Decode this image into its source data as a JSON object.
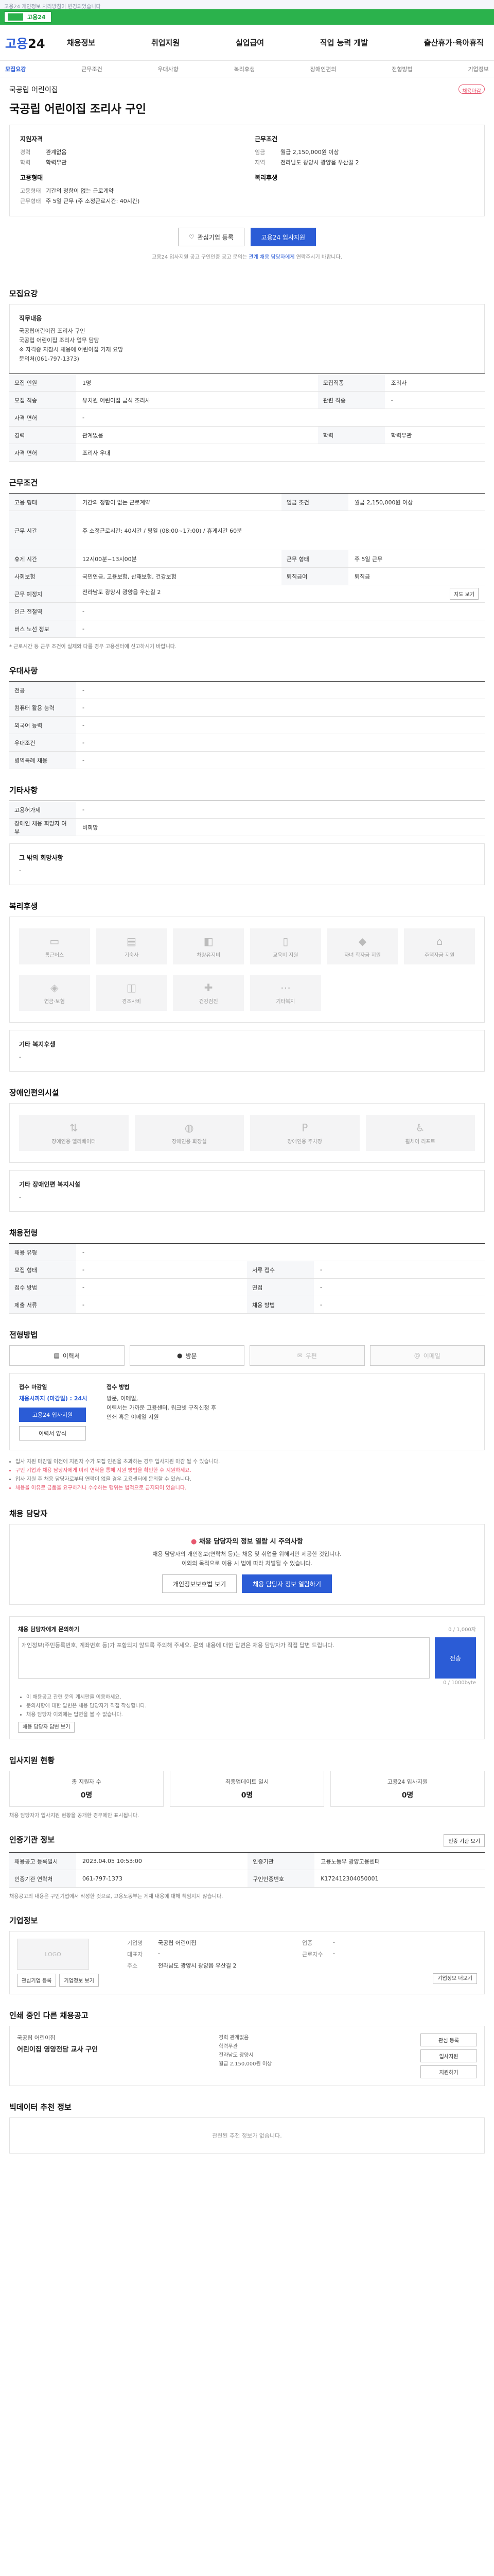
{
  "notice": "고용24 개인정보 처리방침이 변경되었습니다",
  "banner": {
    "label": "고용24"
  },
  "header": {
    "logo_main": "고용",
    "logo_num": "24",
    "gnb": [
      "채용정보",
      "취업지원",
      "실업급여",
      "직업 능력 개발",
      "출산휴가·육아휴직"
    ]
  },
  "subtabs": [
    "모집요강",
    "근무조건",
    "우대사항",
    "복리후생",
    "장애인편의",
    "전형방법",
    "기업정보"
  ],
  "company": {
    "name": "국공립 어린이집",
    "tag": "채용마감"
  },
  "job_title": "국공립 어린이집 조리사 구인",
  "summary": {
    "left_title": "지원자격",
    "left": [
      {
        "k": "경력",
        "v": "관계없음"
      },
      {
        "k": "학력",
        "v": "학력무관"
      }
    ],
    "left2_title": "고용형태",
    "left2": [
      {
        "k": "고용형태",
        "v": "기간의 정함이 없는 근로계약"
      },
      {
        "k": "근무형태",
        "v": "주 5일 근무 (주 소정근로시간: 40시간)"
      }
    ],
    "right_title": "근무조건",
    "right": [
      {
        "k": "임금",
        "v": "월급 2,150,000원 이상"
      },
      {
        "k": "지역",
        "v": "전라남도 광양시 광양읍 우산길 2"
      }
    ],
    "right2_title": "복리후생"
  },
  "actions": {
    "interest": "관심기업 등록",
    "apply": "고용24 입사지원"
  },
  "apply_note_pre": "고용24 입사지원 공고 구인인증 공고 문의는 ",
  "apply_note_link": "관계 채용 담당자에게",
  "apply_note_post": " 연락주시기 바랍니다.",
  "sections": {
    "recruit": "모집요강",
    "work": "근무조건",
    "prefer": "우대사항",
    "etc": "기타사항",
    "welfare": "복리후생",
    "disabled": "장애인편의시설",
    "selection": "채용전형",
    "method": "전형방법",
    "contact": "채용 담당자",
    "qna": "채용 담당자에게 문의하기",
    "stats": "입사지원 현황",
    "provider": "인증기관 정보",
    "company": "기업정보",
    "other": "인쇄 중인 다른 채용공고",
    "bottom": "빅데이터 추천 정보"
  },
  "recruit": {
    "box_title": "직무내용",
    "box_lines": [
      "국공립어린이집 조리사 구인",
      "국공립 어린이집 조리사 업무 담당",
      "※ 자격증 지참시 채용에 어린이집 기재 요망",
      "문의처(061-797-1373)"
    ],
    "rows": [
      {
        "k": "모집 인원",
        "v": "1명",
        "k2": "모집직종",
        "v2": "조리사"
      },
      {
        "k": "모집 직종",
        "v": "유치원 어린이집 급식 조리사",
        "k2": "관련 직종",
        "v2": "-"
      },
      {
        "k": "자격 면허",
        "v": "-",
        "k2": "",
        "v2": ""
      },
      {
        "k": "경력",
        "v": "관계없음",
        "k2": "학력",
        "v2": "학력무관"
      },
      {
        "k": "자격 면허",
        "v": "조리사 우대",
        "k2": "",
        "v2": ""
      }
    ]
  },
  "work": {
    "rows": [
      {
        "k": "고용 형태",
        "v": "기간의 정함이 없는 근로계약",
        "k2": "임금 조건",
        "v2": "월급 2,150,000원 이상"
      },
      {
        "k": "근무 시간",
        "v": "주 소정근로시간: 40시간 / 평일 (08:00~17:00) / 휴게시간 60분",
        "k2": "",
        "v2": ""
      },
      {
        "k": "휴게 시간",
        "v": "12시00분~13시00분",
        "k2": "근무 형태",
        "v2": "주 5일 근무"
      },
      {
        "k": "사회보험",
        "v": "국민연금, 고용보험, 산재보험, 건강보험",
        "k2": "퇴직급여",
        "v2": "퇴직금"
      },
      {
        "k": "근무 예정지",
        "v": "전라남도 광양시 광양읍 우산길 2",
        "k2": "",
        "v2": ""
      },
      {
        "k": "인근 전철역",
        "v": "-",
        "k2": "",
        "v2": ""
      },
      {
        "k": "버스 노선 정보",
        "v": "-",
        "k2": "",
        "v2": ""
      }
    ],
    "more": "지도 보기",
    "footnote": "* 근로시간 등 근무 조건이 실제와 다를 경우 고용센터에 신고하시기 바랍니다."
  },
  "prefer": {
    "rows": [
      {
        "k": "전공",
        "v": "-"
      },
      {
        "k": "컴퓨터 활용 능력",
        "v": "-"
      },
      {
        "k": "외국어 능력",
        "v": "-"
      },
      {
        "k": "우대조건",
        "v": "-"
      },
      {
        "k": "병역특례 채용",
        "v": "-"
      }
    ]
  },
  "etc": {
    "rows": [
      {
        "k": "고용허가제",
        "v": "-"
      },
      {
        "k": "장애인 채용 희망자 여부",
        "v": "비희망"
      }
    ],
    "box_title": "그 밖의 회망사항",
    "box_text": "-"
  },
  "welfare": {
    "items": [
      "통근버스",
      "기숙사",
      "차량유지비",
      "교육비 지원",
      "자녀 학자금 지원",
      "주택자금 지원"
    ],
    "items2": [
      "연금·보험",
      "경조사비",
      "건강검진",
      "기타복지"
    ],
    "box_title": "기타 복지후생",
    "box_text": "-"
  },
  "disabled": {
    "items": [
      "장애인용 엘리베이터",
      "장애인용 화장실",
      "장애인용 주차장",
      "휠체어 리프트"
    ],
    "box_title": "기타 장애인편 복지시설",
    "box_text": "-"
  },
  "selection": {
    "rows": [
      {
        "k": "채용 유형",
        "v": "-",
        "k2": "",
        "v2": ""
      },
      {
        "k": "모집 형태",
        "v": "-",
        "k2": "서류 접수",
        "v2": "-"
      },
      {
        "k": "접수 방법",
        "v": "-",
        "k2": "면접",
        "v2": "-"
      },
      {
        "k": "제출 서류",
        "v": "-",
        "k2": "채용 방법",
        "v2": "-"
      }
    ]
  },
  "method": {
    "buttons": [
      "이력서",
      "방문",
      "우편",
      "이메일"
    ],
    "deadline_h": "접수 마감일",
    "deadline": "채용시까지 (마감일) : 24시",
    "method_h": "접수 방법",
    "method_text": "방문, 이메일,\n이력서는 가까운 고용센터, 워크넷 구직신청 후\n인쇄 혹은 이메일 지원",
    "apply_btn": "고용24 입사지원",
    "form_btn": "이력서 양식",
    "bullets": [
      "입사 지원 마감일 이전에 지원자 수가 모집 인원을 초과하는 경우 입사지원 마감 될 수 있습니다.",
      "구인 기업과 채용 담당자에게 미리 연락을 통해 지원 방법을 확인한 후 지원하세요.",
      "입사 지원 후 채용 담당자로부터 연락이 없을 경우 고용센터에 문의할 수 있습니다.",
      "채용을 이유로 금품을 요구하거나 수수하는 행위는 법적으로 금지되어 있습니다."
    ]
  },
  "contact": {
    "warn": "채용 담당자의 정보 열람 시 주의사항",
    "text1": "채용 담당자의 개인정보(연락처 등)는 채용 및 취업을 위해서만 제공한 것입니다.",
    "text2": "이외의 목적으로 이용 시 법에 따라 처벌될 수 있습니다.",
    "btn1": "개인정보보호법 보기",
    "btn2": "채용 담당자 정보 열람하기"
  },
  "qna": {
    "label": "채용 담당자에게 문의하기",
    "sublabel": "0 / 1,000자",
    "placeholder": "개인정보(주민등록번호, 계좌번호 등)가 포함되지 않도록 주의해 주세요. 문의 내용에 대한 답변은 채용 담당자가 직접 답변 드립니다.",
    "send": "전송",
    "count": "0 / 1000byte",
    "bullets": [
      "이 채용공고 관련 문의 게시판을 이용하세요.",
      "문의사항에 대한 답변은 채용 담당자가 직접 작성합니다.",
      "채용 담당자 이외에는 답변을 볼 수 없습니다."
    ],
    "more": "채용 담당자 답변 보기"
  },
  "stats": [
    {
      "label": "총 지원자 수",
      "value": "0명"
    },
    {
      "label": "최종업데이트 일시",
      "value": "0명"
    },
    {
      "label": "고용24 입사지원",
      "value": "0명"
    }
  ],
  "stats_note": "채용 담당자가 입사지원 현황을 공개한 경우에만 표시됩니다.",
  "provider": {
    "btn": "인증 기관 보기",
    "rows": [
      {
        "k": "채용공고 등록일시",
        "v": "2023.04.05 10:53:00",
        "k2": "인증기관",
        "v2": "고용노동부 광양고용센터"
      },
      {
        "k": "인증기관 연락처",
        "v": "061-797-1373",
        "k2": "구인인증번호",
        "v2": "K172412304050001"
      }
    ],
    "note": "채용공고의 내용은 구인기업에서 작성한 것으로, 고용노동부는 게재 내용에 대해 책임지지 않습니다."
  },
  "company_info": {
    "logo": "LOGO",
    "rows": [
      {
        "k": "기업명",
        "v": "국공립 어린이집",
        "k2": "업종",
        "v2": "-"
      },
      {
        "k": "대표자",
        "v": "-",
        "k2": "근로자수",
        "v2": "-"
      },
      {
        "k": "주소",
        "v": "전라남도 광양시 광양읍 우산길 2",
        "k2": "",
        "v2": ""
      }
    ],
    "btn1": "관심기업 등록",
    "btn2": "기업정보 보기",
    "side": "기업정보 더보기"
  },
  "other": {
    "company": "국공립 어린이집",
    "title": "어린이집 영양전담 교사 구인",
    "meta": [
      "경력 관계없음",
      "학력무관",
      "전라남도 광양시",
      "월급 2,150,000원 이상"
    ],
    "side_btns": [
      "관심 등록",
      "입사지원",
      "지원하기"
    ]
  },
  "bottom": {
    "text": "관련된 추천 정보가 없습니다."
  }
}
